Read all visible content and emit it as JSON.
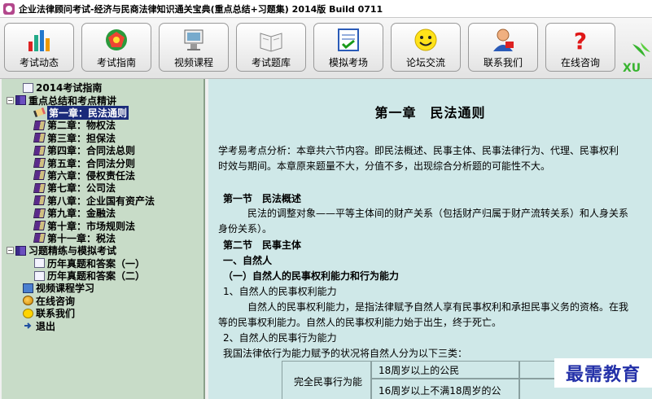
{
  "window": {
    "title": "企业法律顾问考试-经济与民商法律知识通关宝典(重点总结+习题集) 2014版 Build 0711"
  },
  "toolbar": {
    "buttons": [
      {
        "label": "考试动态",
        "icon": "chart-icon"
      },
      {
        "label": "考试指南",
        "icon": "pentagon-icon"
      },
      {
        "label": "视频课程",
        "icon": "video-icon"
      },
      {
        "label": "考试题库",
        "icon": "book-icon"
      },
      {
        "label": "模拟考场",
        "icon": "exam-icon"
      },
      {
        "label": "论坛交流",
        "icon": "smiley-icon"
      },
      {
        "label": "联系我们",
        "icon": "contact-icon"
      },
      {
        "label": "在线咨询",
        "icon": "question-icon"
      }
    ],
    "brand_fragment": "XU"
  },
  "tree": {
    "items": [
      {
        "label": "2014考试指南",
        "expander": "",
        "icon": "doc-icon"
      },
      {
        "label": "重点总结和考点精讲",
        "expander": "−",
        "icon": "book-icon"
      },
      {
        "label": "第一章：民法通则",
        "icon": "pencil-icon",
        "selected": true
      },
      {
        "label": "第二章：物权法",
        "icon": "book-icon"
      },
      {
        "label": "第三章：担保法",
        "icon": "book-icon"
      },
      {
        "label": "第四章：合同法总则",
        "icon": "book-icon"
      },
      {
        "label": "第五章：合同法分则",
        "icon": "book-icon"
      },
      {
        "label": "第六章：侵权责任法",
        "icon": "book-icon"
      },
      {
        "label": "第七章：公司法",
        "icon": "book-icon"
      },
      {
        "label": "第八章：企业国有资产法",
        "icon": "book-icon"
      },
      {
        "label": "第九章：金融法",
        "icon": "book-icon"
      },
      {
        "label": "第十章：市场规则法",
        "icon": "book-icon"
      },
      {
        "label": "第十一章：税法",
        "icon": "book-icon"
      },
      {
        "label": "习题精练与模拟考试",
        "expander": "−",
        "icon": "book-icon"
      },
      {
        "label": "历年真题和答案（一）",
        "icon": "doc-icon"
      },
      {
        "label": "历年真题和答案（二）",
        "icon": "doc-icon"
      },
      {
        "label": "视频课程学习",
        "icon": "monitor-icon"
      },
      {
        "label": "在线咨询",
        "icon": "globe-icon"
      },
      {
        "label": "联系我们",
        "icon": "smiley-icon"
      },
      {
        "label": "退出",
        "icon": "exit-icon"
      }
    ]
  },
  "content": {
    "heading": "第一章　民法通则",
    "intro_1": "学考易考点分析：本章共六节内容。即民法概述、民事主体、民事法律行为、代理、民事权利",
    "intro_2": "时效与期间。本章原来题量不大，分值不多，出现综合分析题的可能性不大。",
    "sec1_title": "第一节　民法概述",
    "sec1_p1": "民法的调整对象——平等主体间的财产关系（包括财产归属于财产流转关系）和人身关系",
    "sec1_p2": "身份关系）。",
    "sec2_title": "第二节　民事主体",
    "sub1": "一、自然人",
    "sub1_1": "（一）自然人的民事权利能力和行为能力",
    "item1": "1、自然人的民事权利能力",
    "item1_p1": "自然人的民事权利能力，是指法律赋予自然人享有民事权利和承担民事义务的资格。在我",
    "item1_p2": "等的民事权利能力。自然人的民事权利能力始于出生，终于死亡。",
    "item2": "2、自然人的民事行为能力",
    "item2_p1": "我国法律依行为能力赋予的状况将自然人分为以下三类：",
    "table": {
      "cat1": "完全民事行为能",
      "row1": "18周岁以上的公民",
      "row2": "16周岁以上不满18周岁的公"
    }
  },
  "watermark": "最需教育",
  "colors": {
    "tree_bg": "#c8dcc8",
    "content_bg": "#cfe8e8",
    "selection": "#1a2a7a",
    "watermark": "#2330a8"
  }
}
